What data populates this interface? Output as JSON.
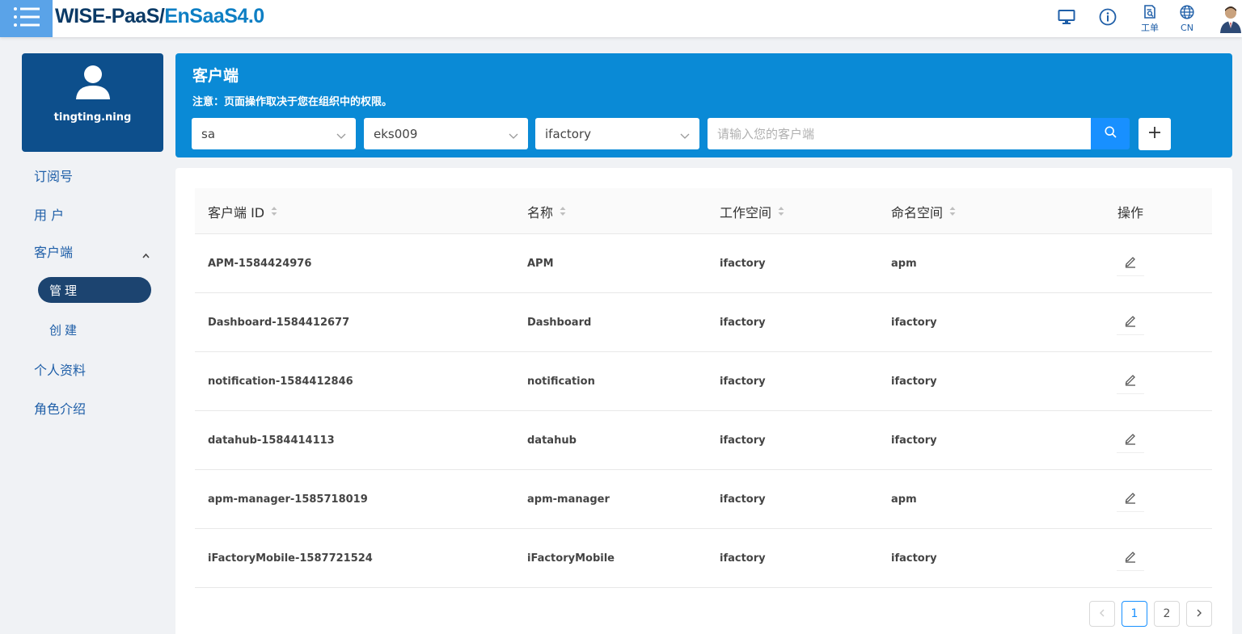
{
  "header": {
    "brand_part1": "WISE-PaaS/",
    "brand_part2": "EnSaaS4.0",
    "ticket_label": "工单",
    "lang_label": "CN"
  },
  "sidebar": {
    "username": "tingting.ning",
    "items": [
      {
        "label": "订阅号"
      },
      {
        "label": "用 户"
      },
      {
        "label": "客户端"
      },
      {
        "label": "个人资料"
      },
      {
        "label": "角色介绍"
      }
    ],
    "sub_items": [
      {
        "label": "管理",
        "active": true
      },
      {
        "label": "创建",
        "active": false
      }
    ]
  },
  "panel": {
    "title": "客户端",
    "note": "注意：页面操作取决于您在组织中的权限。",
    "filters": [
      {
        "value": "sa"
      },
      {
        "value": "eks009"
      },
      {
        "value": "ifactory"
      }
    ],
    "search_placeholder": "请输入您的客户端"
  },
  "table": {
    "columns": [
      "客户端 ID",
      "名称",
      "工作空间",
      "命名空间",
      "操作"
    ],
    "rows": [
      {
        "client_id": "APM-1584424976",
        "name": "APM",
        "workspace": "ifactory",
        "namespace": "apm"
      },
      {
        "client_id": "Dashboard-1584412677",
        "name": "Dashboard",
        "workspace": "ifactory",
        "namespace": "ifactory"
      },
      {
        "client_id": "notification-1584412846",
        "name": "notification",
        "workspace": "ifactory",
        "namespace": "ifactory"
      },
      {
        "client_id": "datahub-1584414113",
        "name": "datahub",
        "workspace": "ifactory",
        "namespace": "ifactory"
      },
      {
        "client_id": "apm-manager-1585718019",
        "name": "apm-manager",
        "workspace": "ifactory",
        "namespace": "apm"
      },
      {
        "client_id": "iFactoryMobile-1587721524",
        "name": "iFactoryMobile",
        "workspace": "ifactory",
        "namespace": "ifactory"
      }
    ]
  },
  "pagination": {
    "pages": [
      "1",
      "2"
    ],
    "current": "1"
  },
  "colors": {
    "panel_bg": "#0a8ad6",
    "user_card_bg": "#0d4f8c",
    "active_nav_bg": "#1c4470",
    "primary": "#1890ff",
    "nav_text": "#1f5fa8"
  }
}
